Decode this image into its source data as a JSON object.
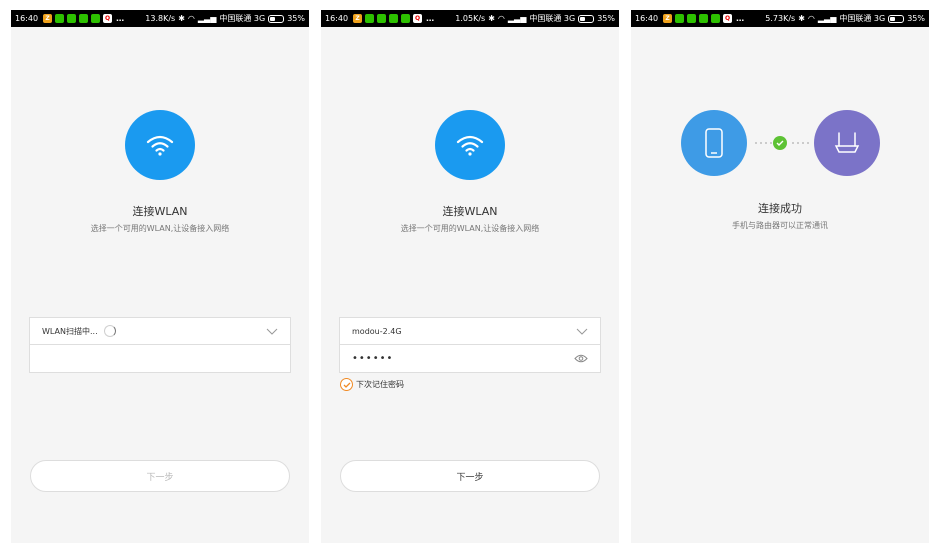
{
  "screens": [
    {
      "status": {
        "time": "16:40",
        "speed": "13.8K/s",
        "carrier": "中国联通 3G",
        "battery": "35%"
      },
      "title": "连接WLAN",
      "subtitle": "选择一个可用的WLAN,让设备接入网络",
      "wifi_select": {
        "value": "WLAN扫描中..."
      },
      "next_label": "下一步",
      "next_enabled": false
    },
    {
      "status": {
        "time": "16:40",
        "speed": "1.05K/s",
        "carrier": "中国联通 3G",
        "battery": "35%"
      },
      "title": "连接WLAN",
      "subtitle": "选择一个可用的WLAN,让设备接入网络",
      "wifi_select": {
        "value": "modou-2.4G"
      },
      "password": {
        "value": "••••••"
      },
      "remember": {
        "label": "下次记住密码",
        "checked": true
      },
      "next_label": "下一步",
      "next_enabled": true
    },
    {
      "status": {
        "time": "16:40",
        "speed": "5.73K/s",
        "carrier": "中国联通 3G",
        "battery": "35%"
      },
      "title": "连接成功",
      "subtitle": "手机与路由器可以正常通讯"
    }
  ],
  "icons": {
    "hero": "wifi-icon",
    "chevron": "chevron-down-icon",
    "eye": "eye-icon",
    "check": "check-icon",
    "phone": "smartphone-icon",
    "router": "router-icon"
  },
  "colors": {
    "primary_blue": "#1a9af0",
    "phone_blue": "#3e9be6",
    "router_purple": "#7b73c8",
    "success_green": "#5dc234",
    "check_orange": "#f08a24"
  }
}
